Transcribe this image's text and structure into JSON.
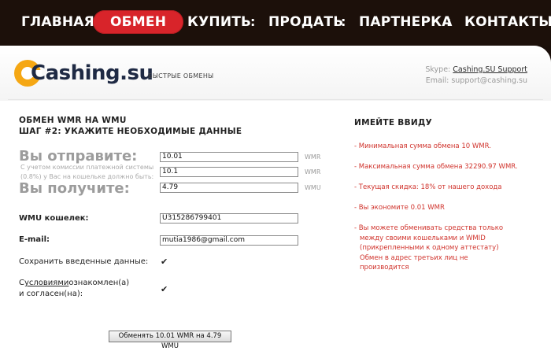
{
  "nav": {
    "items": [
      "ГЛАВНАЯ",
      "ОБМЕН",
      "КУПИТЬ",
      "ПРОДАТЬ",
      "ПАРТНЕРКА",
      "КОНТАКТЫ"
    ],
    "separator": ":"
  },
  "logo": {
    "text": "Cashing.su",
    "tagline": "БЫСТРЫЕ ОБМЕНЫ"
  },
  "contact": {
    "skype_label": "Skype:",
    "skype_value": "Cashing.SU Support",
    "email_label": "Email:",
    "email_value": "support@cashing.su"
  },
  "form": {
    "title_line1": "ОБМЕН WMR НА WMU",
    "title_line2": "ШАГ #2: УКАЖИТЕ НЕОБХОДИМЫЕ ДАННЫЕ",
    "send_label": "Вы отправите:",
    "commission_note_line1": "С учетом комиссии платежной системы",
    "commission_note_line2": "(0.8%) у Вас на кошельке должно быть:",
    "receive_label": "Вы получите:",
    "send_value": "10.01",
    "send_unit": "WMR",
    "commission_value": "10.1",
    "commission_unit": "WMR",
    "receive_value": "4.79",
    "receive_unit": "WMU",
    "wallet_label": "WMU кошелек:",
    "wallet_value": "U315286799401",
    "email_label": "E-mail:",
    "email_value": "mutia1986@gmail.com",
    "save_label": "Сохранить введенные данные:",
    "terms_prefix": "С ",
    "terms_link": "условиями",
    "terms_rest": " ознакомлен(а)",
    "terms_line2": "и согласен(на):",
    "check_mark": "✔",
    "submit_label": "Обменять 10.01 WMR на 4.79 WMU"
  },
  "side": {
    "title": "ИМЕЙТЕ ВВИДУ",
    "notes": [
      "- Минимальная сумма обмена 10 WMR.",
      "- Максимальная сумма обмена 32290.97 WMR.",
      "- Текущая скидка: 18% от нашего дохода",
      "- Вы экономите 0.01 WMR"
    ],
    "note5_lines": [
      "- Вы можете обменивать средства только",
      "  между своими кошельками и WMID",
      "  (прикрепленными к одному аттестату)",
      "  Обмен в адрес третьих лиц не",
      "  производится"
    ]
  },
  "colors": {
    "accent": "#d8242a",
    "nav_bg": "#1c100a",
    "logo_orange": "#f5a713",
    "note_red": "#d0332c"
  }
}
